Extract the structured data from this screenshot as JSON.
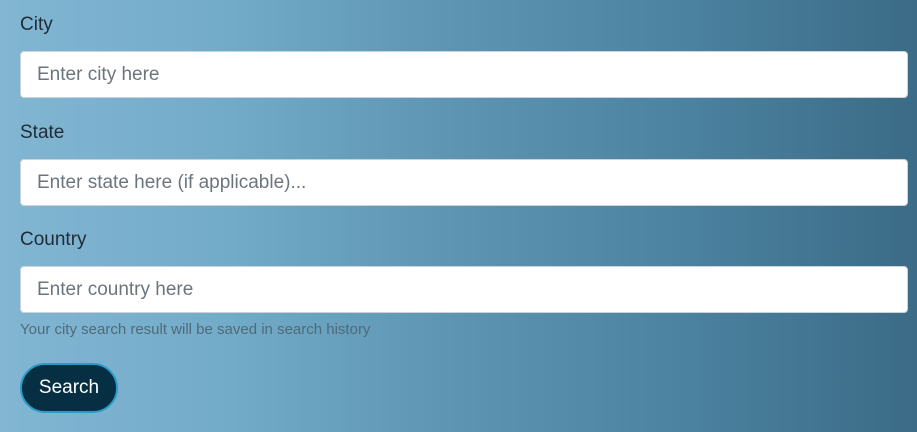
{
  "form": {
    "city": {
      "label": "City",
      "placeholder": "Enter city here",
      "value": ""
    },
    "state": {
      "label": "State",
      "placeholder": "Enter state here (if applicable)...",
      "value": ""
    },
    "country": {
      "label": "Country",
      "placeholder": "Enter country here",
      "value": ""
    },
    "help_text": "Your city search result will be saved in search history",
    "search_label": "Search"
  },
  "colors": {
    "button_bg": "#072f44",
    "button_border": "#2a9bc9",
    "gradient_start": "#82b6d3",
    "gradient_end": "#3b6b86"
  }
}
